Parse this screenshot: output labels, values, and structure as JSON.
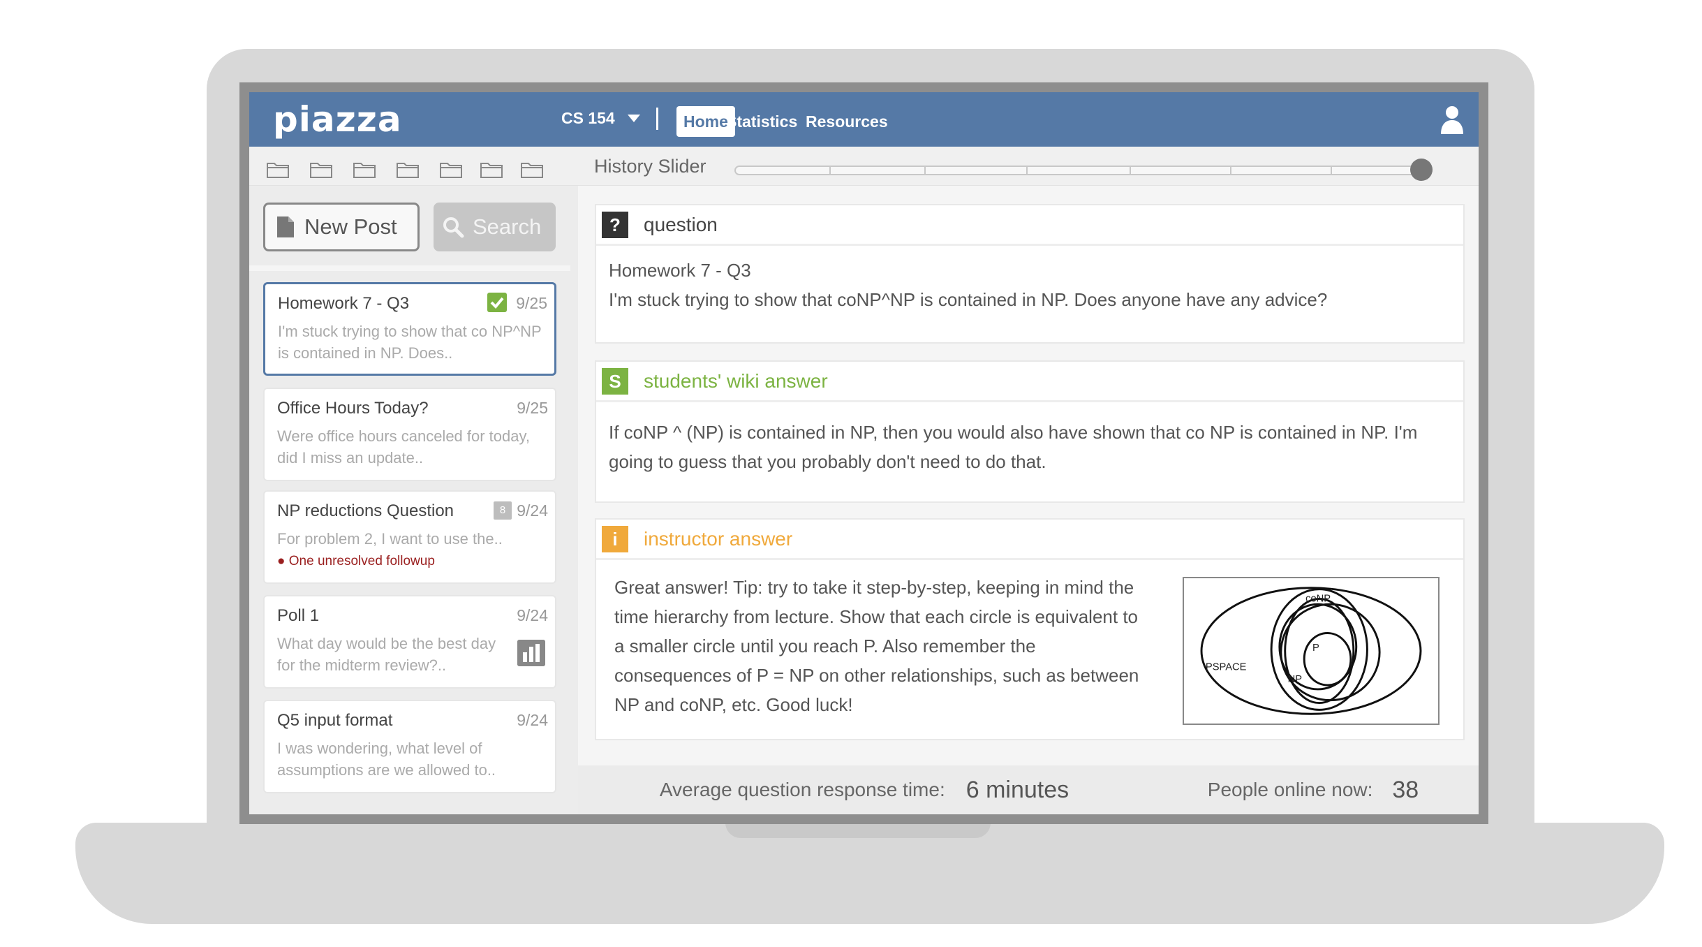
{
  "header": {
    "logo": "piazza",
    "course": "CS 154",
    "nav": {
      "home": "Home",
      "statistics": "Statistics",
      "resources": "Resources"
    }
  },
  "toolbar": {
    "history_label": "History Slider",
    "history_position": 1.0
  },
  "sidebar": {
    "new_post": "New Post",
    "search": "Search",
    "posts": [
      {
        "title": "Homework 7 - Q3",
        "date": "9/25",
        "body": "I'm stuck trying to show that co NP^NP is contained in NP.  Does.."
      },
      {
        "title": "Office Hours Today?",
        "date": "9/25",
        "body": "Were office hours canceled for today, did I miss an update.."
      },
      {
        "title": "NP reductions Question",
        "date": "9/24",
        "badge": "8",
        "body": "For problem 2, I want to use the..",
        "followup": "One unresolved followup"
      },
      {
        "title": "Poll 1",
        "date": "9/24",
        "body": "What day would be the best day for the midterm review?.."
      },
      {
        "title": "Q5 input format",
        "date": "9/24",
        "body": "I was wondering, what level of assumptions are we allowed to.."
      }
    ]
  },
  "question": {
    "tag": "?",
    "label": "question",
    "title": "Homework 7 - Q3",
    "body": "I'm stuck trying to show that coNP^NP is contained in NP.  Does anyone have any advice?"
  },
  "student_answer": {
    "tag": "S",
    "label": "students' wiki answer",
    "body": "If coNP ^ (NP) is contained in NP, then you would also have shown that co NP is contained in NP. I'm going to guess that you probably don't need to do that."
  },
  "instructor_answer": {
    "tag": "i",
    "label": "instructor answer",
    "body": "Great answer! Tip: try to take it step-by-step, keeping in mind the time hierarchy from lecture. Show that each circle is equivalent to a smaller circle until you reach P.  Also remember the consequences of P = NP on other relationships, such as between NP and coNP, etc. Good luck!",
    "diagram_labels": {
      "conp": "coNP",
      "p": "P",
      "pspace": "PSPACE",
      "np": "NP"
    }
  },
  "stats": {
    "response_label": "Average question response time:",
    "response_value": "6 minutes",
    "online_label": "People online now:",
    "online_value": "38"
  },
  "colors": {
    "header": "#5579a6",
    "student": "#7cb342",
    "instructor": "#f0a93b",
    "question": "#333333",
    "followup": "#9a1f1f"
  }
}
